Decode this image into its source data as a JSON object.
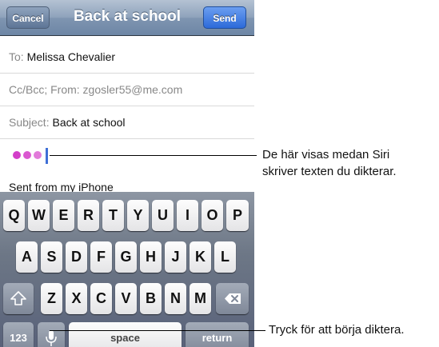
{
  "navbar": {
    "title": "Back at school",
    "cancel_label": "Cancel",
    "send_label": "Send"
  },
  "form": {
    "to_label": "To:",
    "to_value": "Melissa Chevalier",
    "cc_text": "Cc/Bcc; From: zgosler55@me.com",
    "subject_label": "Subject:",
    "subject_value": "Back at school",
    "signature": "Sent from my iPhone"
  },
  "keyboard": {
    "row1": [
      "Q",
      "W",
      "E",
      "R",
      "T",
      "Y",
      "U",
      "I",
      "O",
      "P"
    ],
    "row2": [
      "A",
      "S",
      "D",
      "F",
      "G",
      "H",
      "J",
      "K",
      "L"
    ],
    "row3": [
      "Z",
      "X",
      "C",
      "V",
      "B",
      "N",
      "M"
    ],
    "numbers_label": "123",
    "space_label": "space",
    "return_label": "return"
  },
  "annotations": {
    "siri_dots_line1": "De här visas medan Siri",
    "siri_dots_line2": "skriver texten du dikterar.",
    "mic": "Tryck för att börja diktera."
  },
  "colors": {
    "siri_dots": "#d33fc9",
    "caret": "#3e6fd6",
    "send_button": "#2c6ad9"
  }
}
